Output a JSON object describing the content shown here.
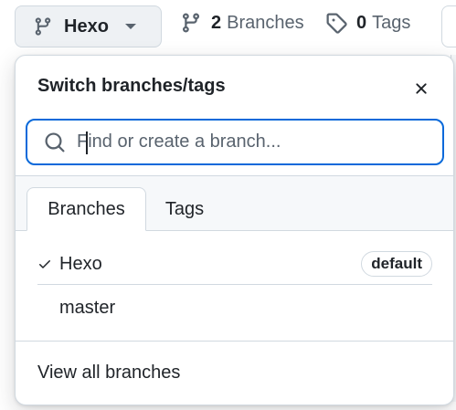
{
  "toolbar": {
    "branch_select": {
      "label": "Hexo",
      "icon": "git-branch-icon"
    },
    "branches_link": {
      "count": "2",
      "label": "Branches",
      "icon": "git-branch-icon"
    },
    "tags_link": {
      "count": "0",
      "label": "Tags",
      "icon": "tag-icon"
    }
  },
  "dropdown": {
    "title": "Switch branches/tags",
    "close_icon": "close-icon",
    "search": {
      "placeholder": "Find or create a branch...",
      "value": "",
      "icon": "search-icon"
    },
    "tabs": [
      {
        "label": "Branches",
        "selected": true
      },
      {
        "label": "Tags",
        "selected": false
      }
    ],
    "items": [
      {
        "name": "Hexo",
        "checked": true,
        "badge": "default"
      },
      {
        "name": "master",
        "checked": false,
        "badge": ""
      }
    ],
    "footer_link": "View all branches"
  },
  "colors": {
    "accent": "#0969da",
    "text": "#1f2328",
    "muted": "#59636e",
    "border": "#d1d9e0",
    "button_bg": "#eef1f4"
  }
}
